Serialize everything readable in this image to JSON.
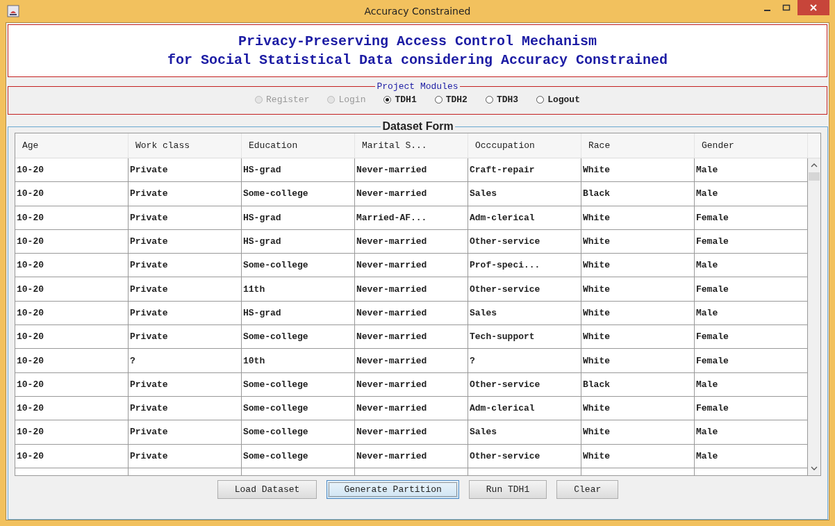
{
  "window": {
    "title": "Accuracy Constrained"
  },
  "header": {
    "lines": [
      "Privacy-Preserving Access Control Mechanism",
      "for Social Statistical Data considering Accuracy Constrained"
    ]
  },
  "modules": {
    "title": "Project Modules",
    "items": [
      {
        "label": "Register",
        "selected": false,
        "disabled": true
      },
      {
        "label": "Login",
        "selected": false,
        "disabled": true
      },
      {
        "label": "TDH1",
        "selected": true,
        "disabled": false
      },
      {
        "label": "TDH2",
        "selected": false,
        "disabled": false
      },
      {
        "label": "TDH3",
        "selected": false,
        "disabled": false
      },
      {
        "label": "Logout",
        "selected": false,
        "disabled": false
      }
    ]
  },
  "dataset": {
    "title": "Dataset Form",
    "table": {
      "columns": [
        "Age",
        "Work class",
        "Education",
        "Marital S...",
        "Occcupation",
        "Race",
        "Gender"
      ],
      "rows": [
        [
          "10-20",
          "Private",
          "HS-grad",
          "Never-married",
          "Craft-repair",
          "White",
          "Male"
        ],
        [
          "10-20",
          "Private",
          "Some-college",
          "Never-married",
          "Sales",
          "Black",
          "Male"
        ],
        [
          "10-20",
          "Private",
          "HS-grad",
          "Married-AF...",
          "Adm-clerical",
          "White",
          "Female"
        ],
        [
          "10-20",
          "Private",
          "HS-grad",
          "Never-married",
          "Other-service",
          "White",
          "Female"
        ],
        [
          "10-20",
          "Private",
          "Some-college",
          "Never-married",
          "Prof-speci...",
          "White",
          "Male"
        ],
        [
          "10-20",
          "Private",
          "11th",
          "Never-married",
          "Other-service",
          "White",
          "Female"
        ],
        [
          "10-20",
          "Private",
          "HS-grad",
          "Never-married",
          "Sales",
          "White",
          "Male"
        ],
        [
          "10-20",
          "Private",
          "Some-college",
          "Never-married",
          "Tech-support",
          "White",
          "Female"
        ],
        [
          "10-20",
          "?",
          "10th",
          "Never-married",
          "?",
          "White",
          "Female"
        ],
        [
          "10-20",
          "Private",
          "Some-college",
          "Never-married",
          "Other-service",
          "Black",
          "Male"
        ],
        [
          "10-20",
          "Private",
          "Some-college",
          "Never-married",
          "Adm-clerical",
          "White",
          "Female"
        ],
        [
          "10-20",
          "Private",
          "Some-college",
          "Never-married",
          "Sales",
          "White",
          "Male"
        ],
        [
          "10-20",
          "Private",
          "Some-college",
          "Never-married",
          "Other-service",
          "White",
          "Male"
        ]
      ]
    },
    "buttons": [
      {
        "label": "Load Dataset",
        "focused": false
      },
      {
        "label": "Generate Partition",
        "focused": true
      },
      {
        "label": "Run TDH1",
        "focused": false
      },
      {
        "label": "Clear",
        "focused": false
      }
    ]
  }
}
